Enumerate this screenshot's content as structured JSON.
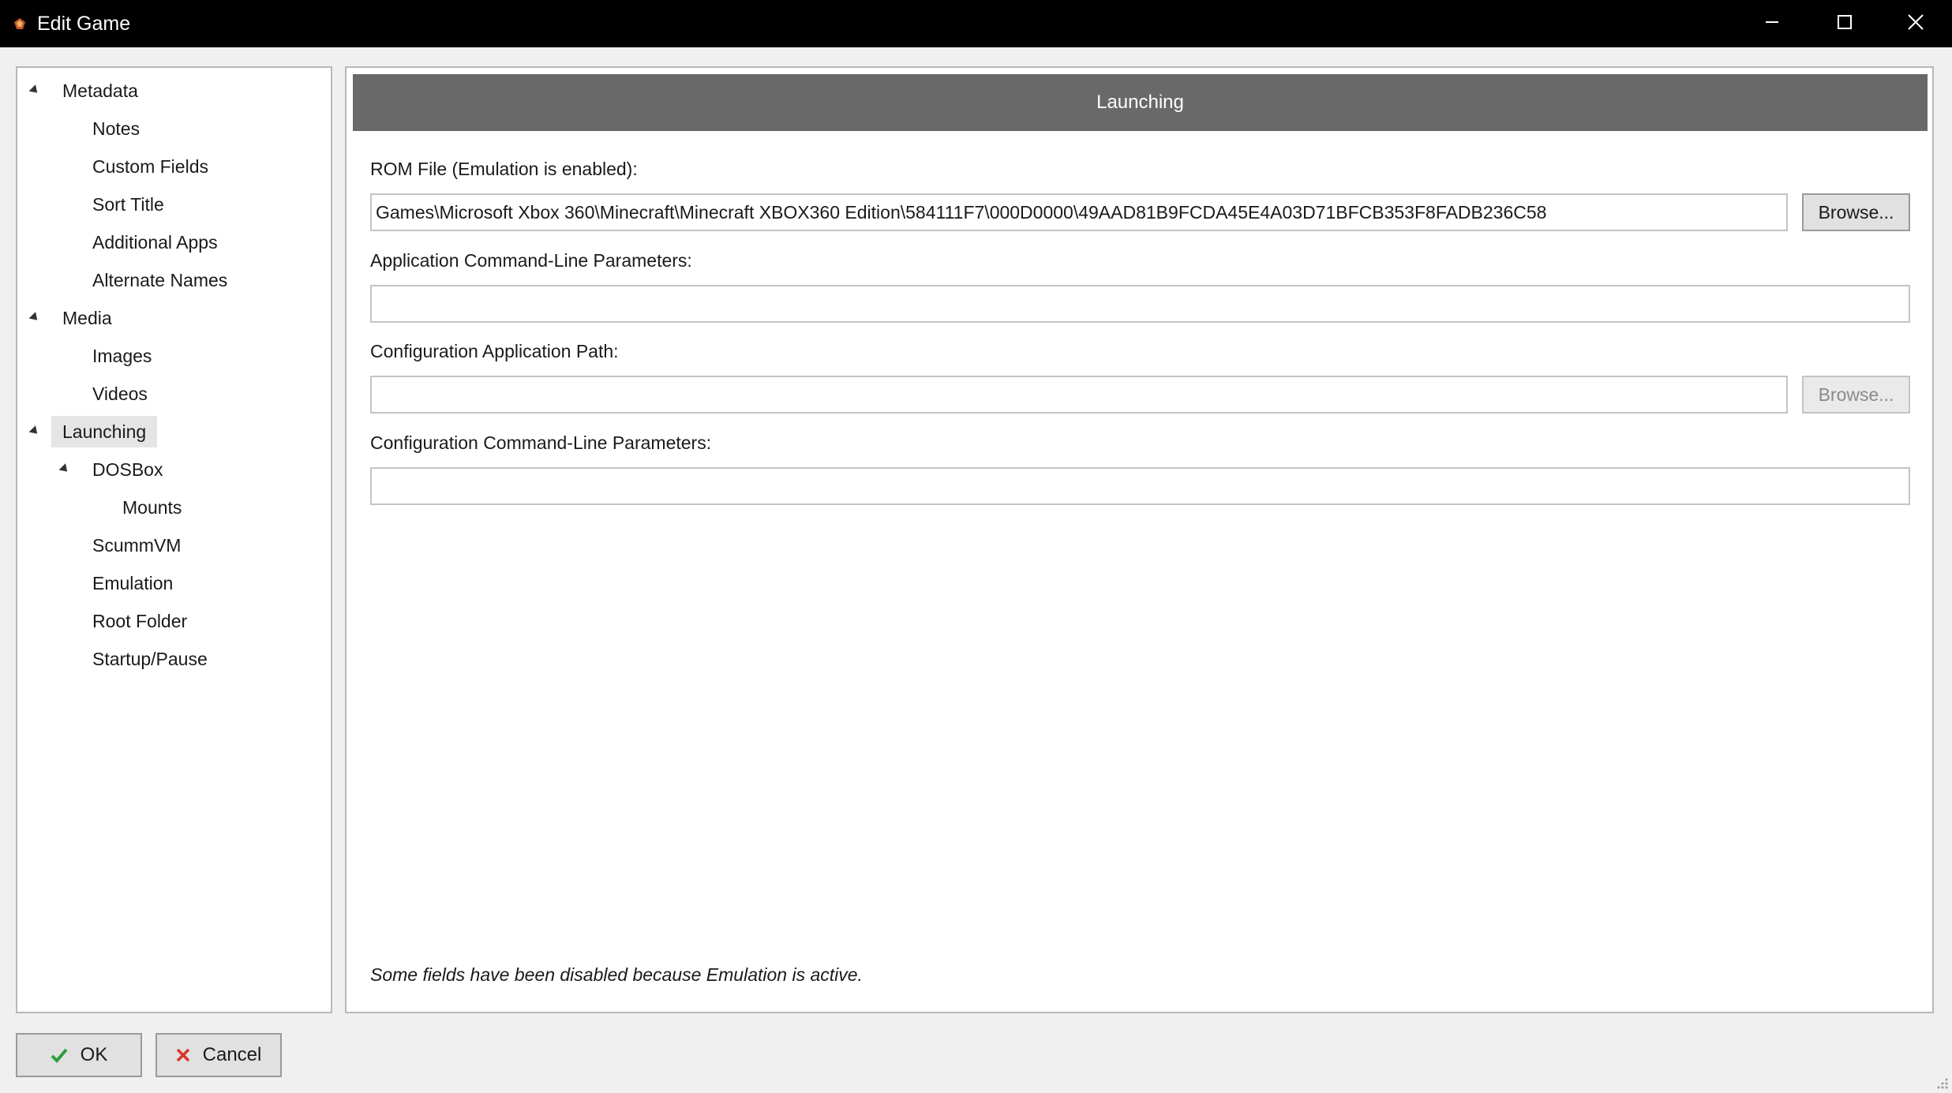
{
  "window": {
    "title": "Edit Game",
    "controls": [
      "minimize-icon",
      "maximize-icon",
      "close-icon"
    ]
  },
  "tree": {
    "items": [
      {
        "label": "Metadata",
        "level": 0,
        "expanded": true
      },
      {
        "label": "Notes",
        "level": 1
      },
      {
        "label": "Custom Fields",
        "level": 1
      },
      {
        "label": "Sort Title",
        "level": 1
      },
      {
        "label": "Additional Apps",
        "level": 1
      },
      {
        "label": "Alternate Names",
        "level": 1
      },
      {
        "label": "Media",
        "level": 0,
        "expanded": true
      },
      {
        "label": "Images",
        "level": 1
      },
      {
        "label": "Videos",
        "level": 1
      },
      {
        "label": "Launching",
        "level": 0,
        "expanded": true,
        "selected": true
      },
      {
        "label": "DOSBox",
        "level": 1,
        "expanded": true
      },
      {
        "label": "Mounts",
        "level": 2
      },
      {
        "label": "ScummVM",
        "level": 1
      },
      {
        "label": "Emulation",
        "level": 1
      },
      {
        "label": "Root Folder",
        "level": 1
      },
      {
        "label": "Startup/Pause",
        "level": 1
      }
    ]
  },
  "content": {
    "header": "Launching",
    "rom_file": {
      "label": "ROM File (Emulation is enabled):",
      "value": "Games\\Microsoft Xbox 360\\Minecraft\\Minecraft XBOX360 Edition\\584111F7\\000D0000\\49AAD81B9FCDA45E4A03D71BFCB353F8FADB236C58",
      "browse_label": "Browse..."
    },
    "app_params": {
      "label": "Application Command-Line Parameters:",
      "value": ""
    },
    "config_path": {
      "label": "Configuration Application Path:",
      "value": "",
      "browse_label": "Browse..."
    },
    "config_params": {
      "label": "Configuration Command-Line Parameters:",
      "value": ""
    },
    "note": "Some fields have been disabled because Emulation is active."
  },
  "buttons": {
    "ok_label": "OK",
    "cancel_label": "Cancel",
    "ok_icon": "checkmark-icon",
    "cancel_icon": "x-icon"
  },
  "colors": {
    "titlebar": "#000000",
    "header_bg": "#696969",
    "selection_bg": "#e5e5e5",
    "ok_check": "#2e9e3e",
    "cancel_x": "#d9342b"
  }
}
